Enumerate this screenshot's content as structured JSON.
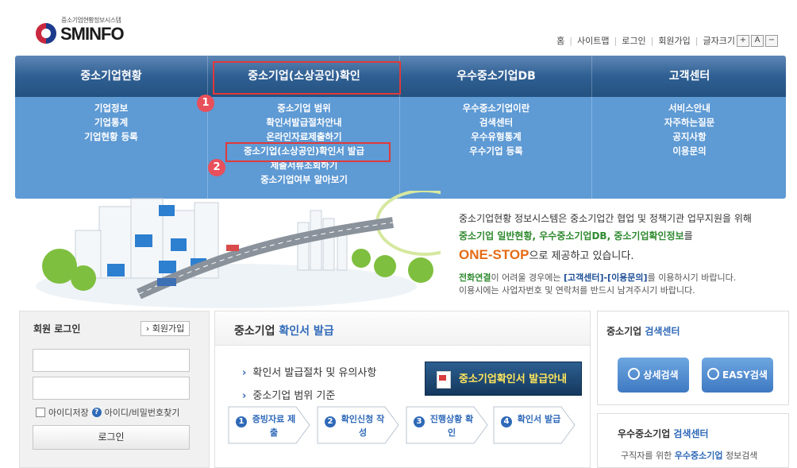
{
  "header": {
    "logo_subtitle": "중소기업현황정보시스템",
    "logo_text": "SMINFO",
    "util_links": [
      "홈",
      "사이트맵",
      "로그인",
      "회원가입"
    ],
    "font_size_label": "글자크기",
    "font_size_buttons": [
      "+",
      "A",
      "−"
    ]
  },
  "nav": {
    "columns": [
      {
        "title": "중소기업현황",
        "items": [
          "기업정보",
          "기업통계",
          "기업현황 등록"
        ]
      },
      {
        "title": "중소기업(소상공인)확인",
        "items": [
          "중소기업 범위",
          "확인서발급절차안내",
          "온라인자료제출하기",
          "중소기업(소상공인)확인서 발급",
          "제출서류조회하기",
          "중소기업여부 알아보기"
        ]
      },
      {
        "title": "우수중소기업DB",
        "items": [
          "우수중소기업이란",
          "검색센터",
          "우수유형통계",
          "우수기업 등록"
        ]
      },
      {
        "title": "고객센터",
        "items": [
          "서비스안내",
          "자주하는질문",
          "공지사항",
          "이용문의"
        ]
      }
    ],
    "markers": [
      "1",
      "2"
    ]
  },
  "intro": {
    "line1": "중소기업현황 정보시스템은 중소기업간 협업 및 정책기관 업무지원을 위해",
    "line2_highlight": "중소기업 일반현황, 우수중소기업DB, 중소기업확인정보",
    "line2_rest": "를",
    "one_stop": "ONE-STOP",
    "line3_rest": "으로 제공하고 있습니다.",
    "contact_pre": "전화연결",
    "contact_mid": "이 어려울 경우에는 ",
    "contact_link": "[고객센터]-[이용문의]",
    "contact_post": "를 이용하시기 바랍니다.",
    "contact_line2": "이용시에는 사업자번호 및 연락처를 반드시 남겨주시기 바랍니다."
  },
  "login": {
    "title": "회원 로그인",
    "join": "회원가입",
    "save_id": "아이디저장",
    "find_id": "아이디/비밀번호찾기",
    "login_button": "로그인"
  },
  "issue": {
    "title_pre": "중소기업 ",
    "title_hl": "확인서 발급",
    "link1": "확인서 발급절차 및 유의사항",
    "link2": "중소기업 범위 기준",
    "guide_button": "중소기업확인서 발급안내",
    "steps": [
      {
        "num": "1",
        "label": "증빙자료 제출"
      },
      {
        "num": "2",
        "label": "확인신청 작성"
      },
      {
        "num": "3",
        "label": "진행상황 확인"
      },
      {
        "num": "4",
        "label": "확인서 발급"
      }
    ]
  },
  "search_center": {
    "title_pre": "중소기업 ",
    "title_hl": "검색센터",
    "detail_button": "상세검색",
    "easy_button": "EASY검색"
  },
  "excellent_center": {
    "title_pre": "우수중소기업 ",
    "title_hl": "검색센터",
    "sub_pre": "구직자를 위한 ",
    "sub_hl": "우수중소기업",
    "sub_post": " 정보검색"
  },
  "colors": {
    "nav_dark": "#2f5f93",
    "nav_light": "#5e9ad4",
    "highlight_red": "#e03a3a",
    "accent_blue": "#2f69b8",
    "one_stop_orange": "#e56b15",
    "intro_green": "#2f8a2f"
  }
}
